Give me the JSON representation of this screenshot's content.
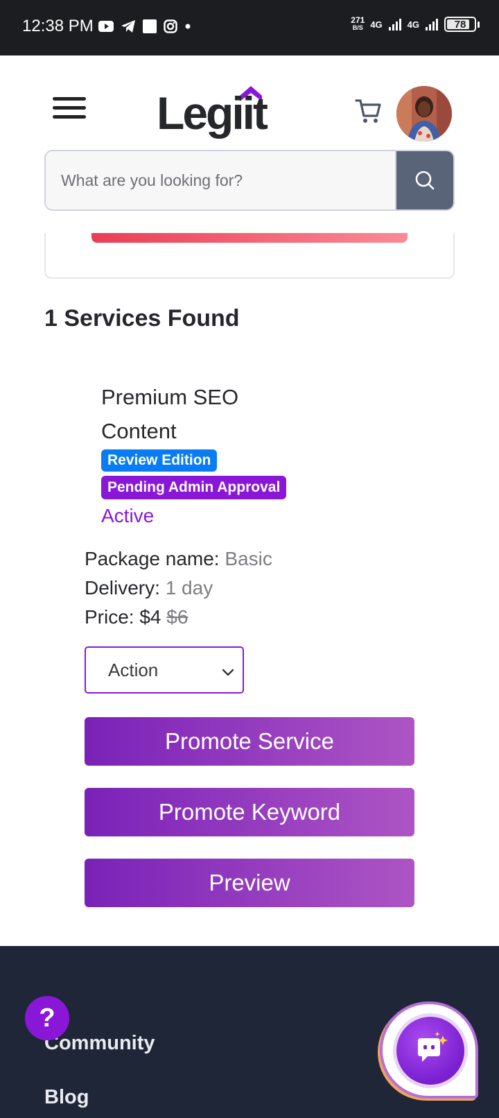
{
  "status_bar": {
    "time": "12:38 PM",
    "net_rate_value": "271",
    "net_rate_unit": "B/S",
    "net_type_1": "4G",
    "net_type_2": "4G",
    "battery": "78"
  },
  "header": {
    "logo_text": "Legiit",
    "search_placeholder": "What are you looking for?"
  },
  "results": {
    "found_text": "1 Services Found"
  },
  "service": {
    "title": "Premium SEO Content",
    "badge_review": "Review Edition",
    "badge_pending": "Pending Admin Approval",
    "status": "Active",
    "package_label": "Package name:",
    "package_value": "Basic",
    "delivery_label": "Delivery:",
    "delivery_value": "1 day",
    "price_label": "Price:",
    "price_value": "$4",
    "price_original": "$6",
    "action_select": "Action",
    "btn_promote_service": "Promote Service",
    "btn_promote_keyword": "Promote Keyword",
    "btn_preview": "Preview"
  },
  "footer": {
    "link_community": "Community",
    "link_blog": "Blog"
  },
  "help_fab": "?",
  "colors": {
    "accent_purple": "#8a17d8",
    "badge_blue": "#0a7cf3",
    "footer_bg": "#1e2637",
    "progress_red": "#ea3d55"
  }
}
